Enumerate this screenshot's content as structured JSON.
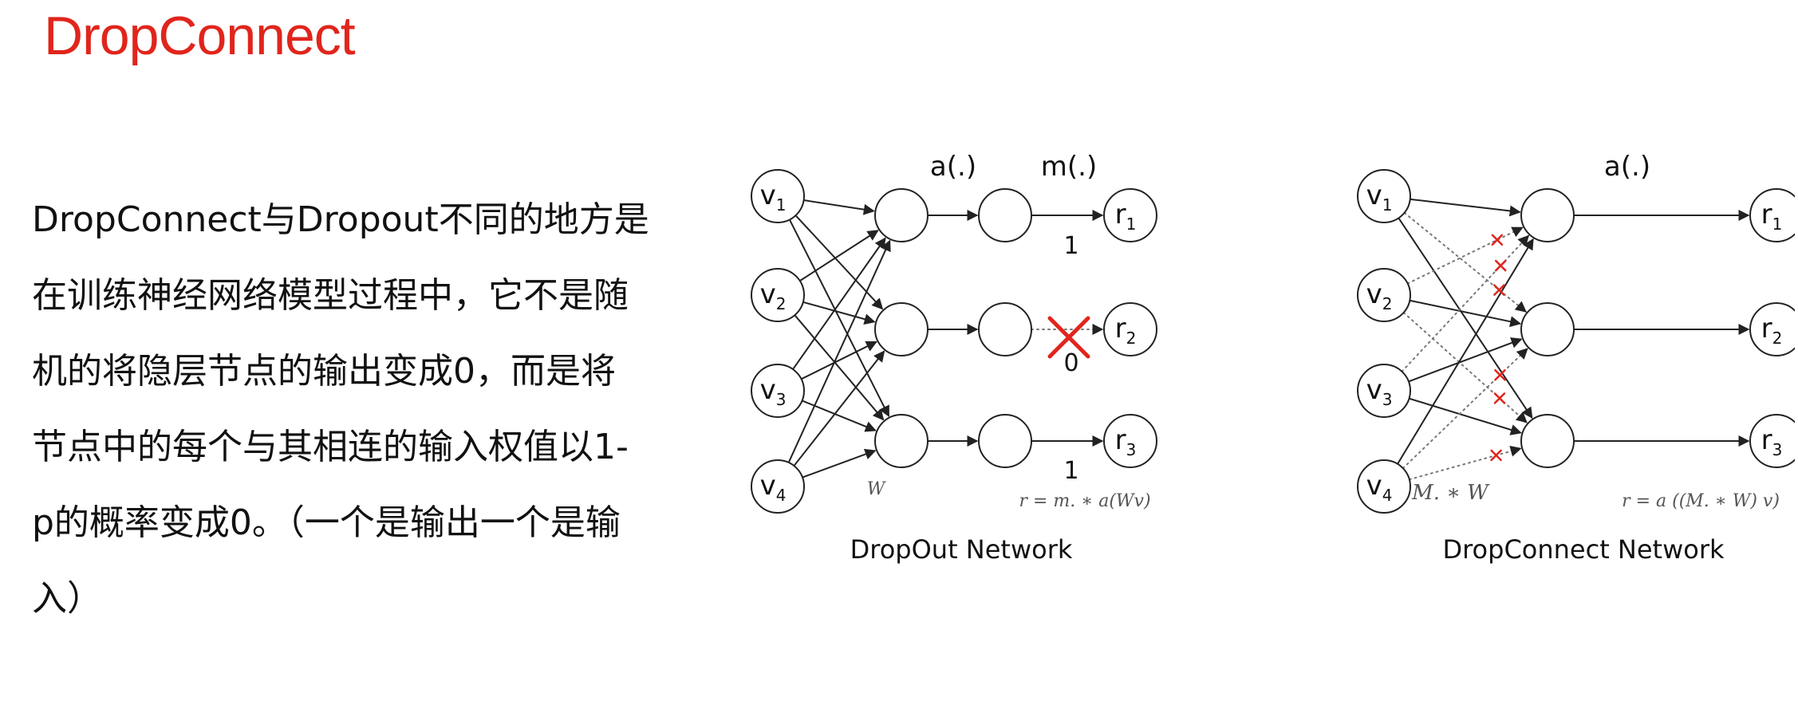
{
  "title": "DropConnect",
  "text_lines": [
    "DropConnect与Dropout不同的地方是",
    "在训练神经网络模型过程中，它不是随",
    "机的将隐层节点的输出变成0，而是将",
    "节点中的每个与其相连的输入权值以1-",
    "p的概率变成0。（一个是输出一个是输",
    "入）"
  ],
  "colors": {
    "title": "#e0251c",
    "drop_mark": "#e0251c",
    "text": "#111111",
    "node_stroke": "#222222"
  },
  "dropout": {
    "caption": "DropOut Network",
    "inputs": [
      "v1",
      "v2",
      "v3",
      "v4"
    ],
    "outputs": [
      "r1",
      "r2",
      "r3"
    ],
    "activation_label": "a(.)",
    "mask_label": "m(.)",
    "mask_values": [
      "1",
      "0",
      "1"
    ],
    "weight_label": "W",
    "formula": "r = m. ∗ a(Wv)"
  },
  "dropconnect": {
    "caption": "DropConnect Network",
    "inputs": [
      "v1",
      "v2",
      "v3",
      "v4"
    ],
    "outputs": [
      "r1",
      "r2",
      "r3"
    ],
    "activation_label": "a(.)",
    "weight_label": "M. ∗ W",
    "formula": "r = a ((M. ∗ W) v)"
  }
}
